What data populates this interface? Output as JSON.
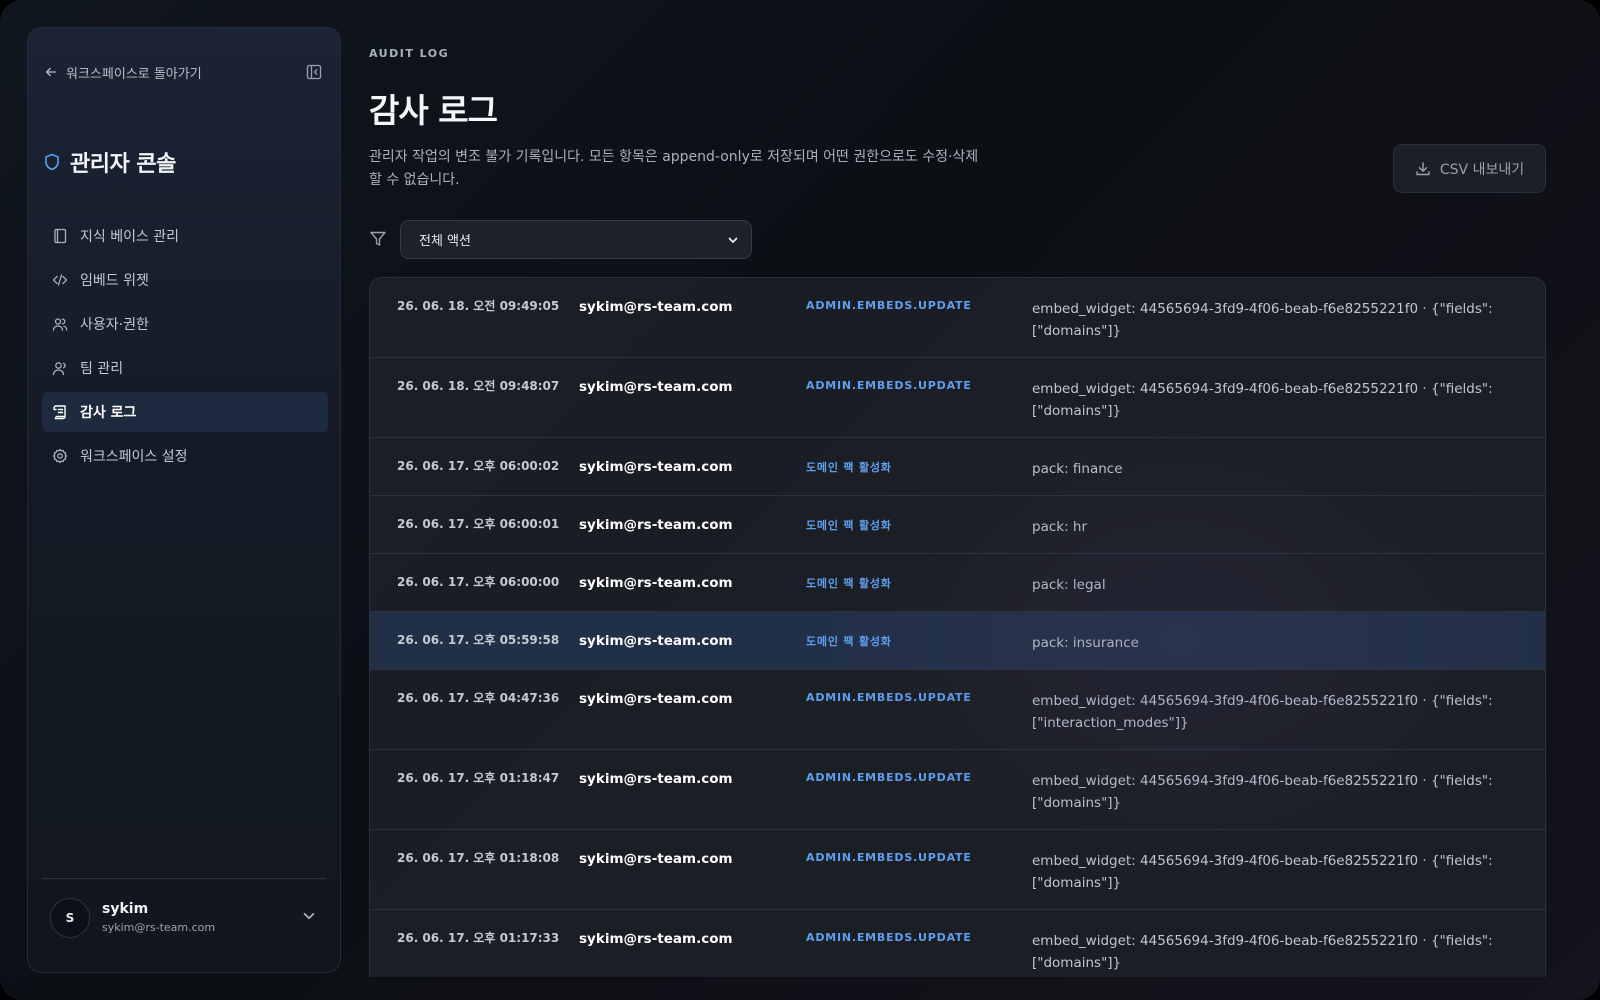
{
  "sidebar": {
    "back_label": "워크스페이스로 돌아가기",
    "title": "관리자 콘솔",
    "items": [
      {
        "label": "지식 베이스 관리",
        "icon": "book-icon"
      },
      {
        "label": "임베드 위젯",
        "icon": "code-icon"
      },
      {
        "label": "사용자·권한",
        "icon": "users-icon"
      },
      {
        "label": "팀 관리",
        "icon": "team-icon"
      },
      {
        "label": "감사 로그",
        "icon": "scroll-icon",
        "active": true
      },
      {
        "label": "워크스페이스 설정",
        "icon": "gear-icon"
      }
    ],
    "user": {
      "initial": "S",
      "name": "sykim",
      "email": "sykim@rs-team.com"
    }
  },
  "header": {
    "eyebrow": "AUDIT LOG",
    "title": "감사 로그",
    "description": "관리자 작업의 변조 불가 기록입니다. 모든 항목은 append-only로 저장되며 어떤 권한으로도 수정·삭제할 수 없습니다.",
    "export_label": "CSV 내보내기"
  },
  "filter": {
    "selected": "전체 액션"
  },
  "colors": {
    "accent": "#5f9ff0",
    "highlight_row": "#223047"
  },
  "rows": [
    {
      "time": "26. 06. 18. 오전 09:49:05",
      "actor": "sykim@rs-team.com",
      "action": "ADMIN.EMBEDS.UPDATE",
      "detail": "embed_widget: 44565694-3fd9-4f06-beab-f6e8255221f0 · {\"fields\":[\"domains\"]}",
      "tall": true
    },
    {
      "time": "26. 06. 18. 오전 09:48:07",
      "actor": "sykim@rs-team.com",
      "action": "ADMIN.EMBEDS.UPDATE",
      "detail": "embed_widget: 44565694-3fd9-4f06-beab-f6e8255221f0 · {\"fields\":[\"domains\"]}",
      "tall": true
    },
    {
      "time": "26. 06. 17. 오후 06:00:02",
      "actor": "sykim@rs-team.com",
      "action": "도메인 팩 활성화",
      "detail": "pack: finance"
    },
    {
      "time": "26. 06. 17. 오후 06:00:01",
      "actor": "sykim@rs-team.com",
      "action": "도메인 팩 활성화",
      "detail": "pack: hr"
    },
    {
      "time": "26. 06. 17. 오후 06:00:00",
      "actor": "sykim@rs-team.com",
      "action": "도메인 팩 활성화",
      "detail": "pack: legal"
    },
    {
      "time": "26. 06. 17. 오후 05:59:58",
      "actor": "sykim@rs-team.com",
      "action": "도메인 팩 활성화",
      "detail": "pack: insurance",
      "highlight": true
    },
    {
      "time": "26. 06. 17. 오후 04:47:36",
      "actor": "sykim@rs-team.com",
      "action": "ADMIN.EMBEDS.UPDATE",
      "detail": "embed_widget: 44565694-3fd9-4f06-beab-f6e8255221f0 · {\"fields\":[\"interaction_modes\"]}",
      "tall": true
    },
    {
      "time": "26. 06. 17. 오후 01:18:47",
      "actor": "sykim@rs-team.com",
      "action": "ADMIN.EMBEDS.UPDATE",
      "detail": "embed_widget: 44565694-3fd9-4f06-beab-f6e8255221f0 · {\"fields\":[\"domains\"]}",
      "tall": true
    },
    {
      "time": "26. 06. 17. 오후 01:18:08",
      "actor": "sykim@rs-team.com",
      "action": "ADMIN.EMBEDS.UPDATE",
      "detail": "embed_widget: 44565694-3fd9-4f06-beab-f6e8255221f0 · {\"fields\":[\"domains\"]}",
      "tall": true
    },
    {
      "time": "26. 06. 17. 오후 01:17:33",
      "actor": "sykim@rs-team.com",
      "action": "ADMIN.EMBEDS.UPDATE",
      "detail": "embed_widget: 44565694-3fd9-4f06-beab-f6e8255221f0 · {\"fields\":[\"domains\"]}",
      "tall": true
    }
  ]
}
